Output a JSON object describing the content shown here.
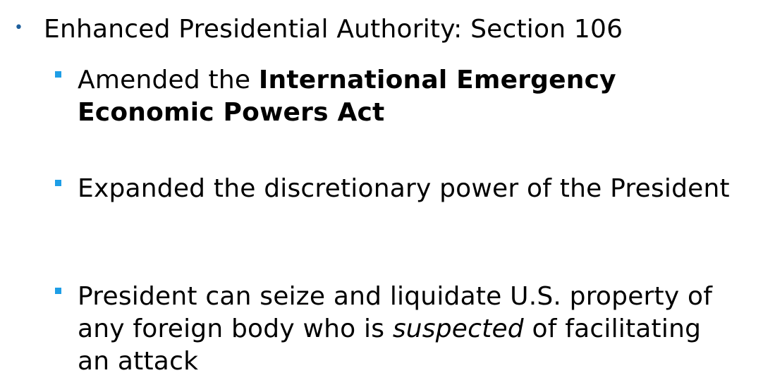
{
  "slide": {
    "top_item": {
      "text": "Enhanced Presidential Authority: Section 106"
    },
    "sub_items": [
      {
        "part1": "Amended the ",
        "bold": "International Emergency Economic Powers Act"
      },
      {
        "text": "Expanded the discretionary power of the President"
      },
      {
        "part1": "President can seize and liquidate U.S. property of any foreign body who is ",
        "italic": "suspected",
        "part2": " of facilitating an attack"
      }
    ],
    "colors": {
      "top_bullet": "#1d5f9c",
      "sub_bullet": "#1e9ee6",
      "text": "#000000",
      "background": "#ffffff"
    },
    "icons": {
      "top_bullet": "round-bullet-icon",
      "sub_bullet": "square-bullet-icon"
    }
  }
}
